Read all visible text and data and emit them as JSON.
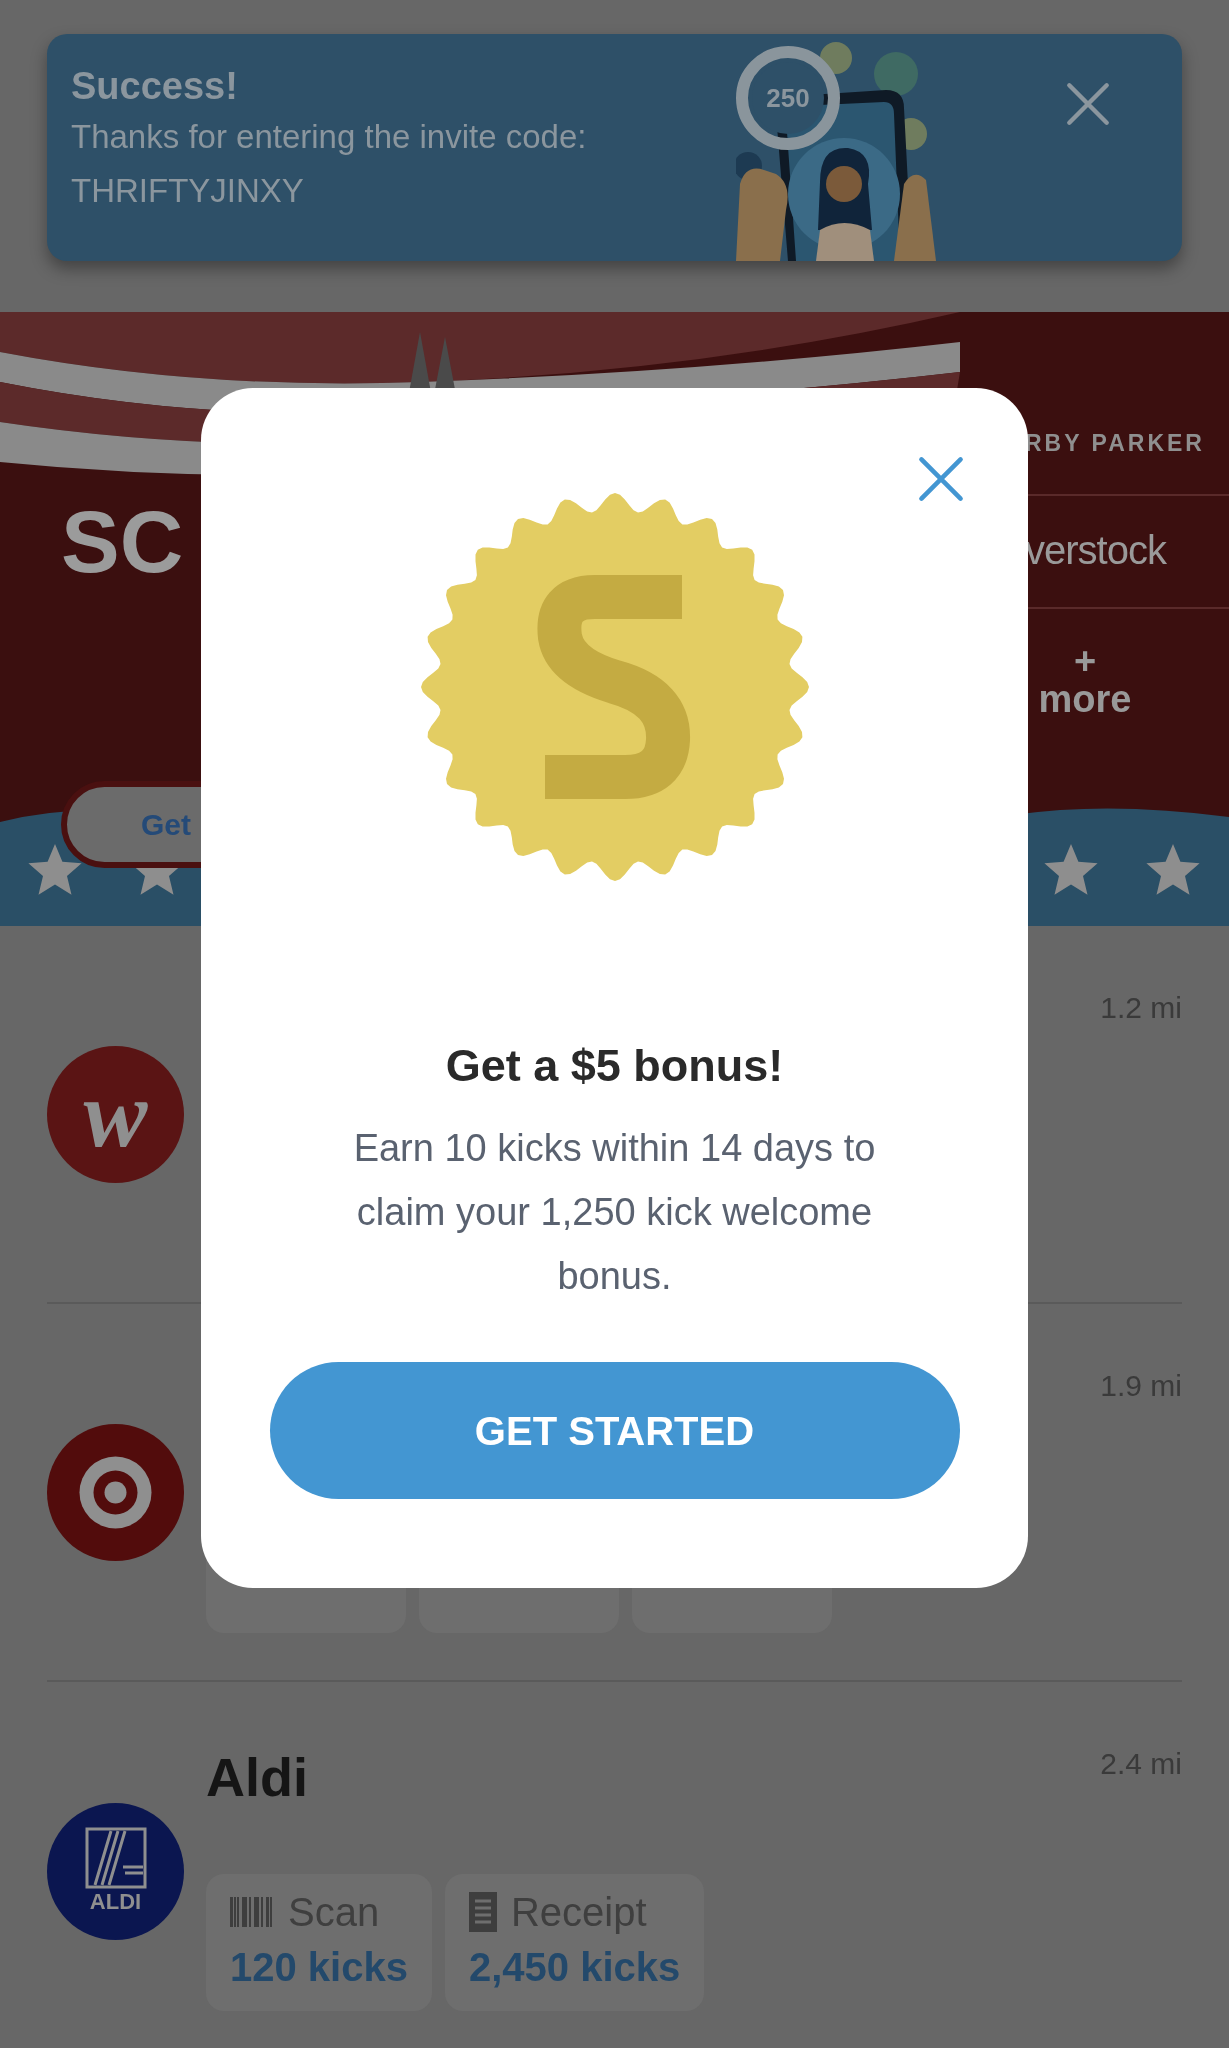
{
  "notification": {
    "title": "Success!",
    "message": "Thanks for entering the invite code:",
    "code": "THRIFTYJINXY",
    "badge": "250"
  },
  "promo_banner": {
    "headline": "SC",
    "button": "Get",
    "brands": [
      {
        "kind": "caps",
        "label": "RBY PARKER"
      },
      {
        "kind": "wordmark",
        "label": "verstock"
      },
      {
        "kind": "more",
        "symbol": "+",
        "label": "more"
      }
    ]
  },
  "stores": [
    {
      "kind": "script",
      "logo_text": "w",
      "distance": "1.2 mi"
    },
    {
      "kind": "bullseye",
      "distance": "1.9 mi",
      "offers": [
        {
          "kind": "covered"
        },
        {
          "kind": "covered"
        },
        {
          "kind": "covered"
        }
      ]
    },
    {
      "kind": "block",
      "logo_text": "ALDI",
      "name": "Aldi",
      "distance": "2.4 mi",
      "offers": [
        {
          "kind": "scan",
          "label": "Scan",
          "kicks": "120 kicks"
        },
        {
          "kind": "receipt",
          "label": "Receipt",
          "kicks": "2,450 kicks"
        }
      ]
    }
  ],
  "modal": {
    "title": "Get a $5 bonus!",
    "message": "Earn 10 kicks within 14 days to claim your 1,250 kick welcome bonus.",
    "button": "GET STARTED"
  }
}
